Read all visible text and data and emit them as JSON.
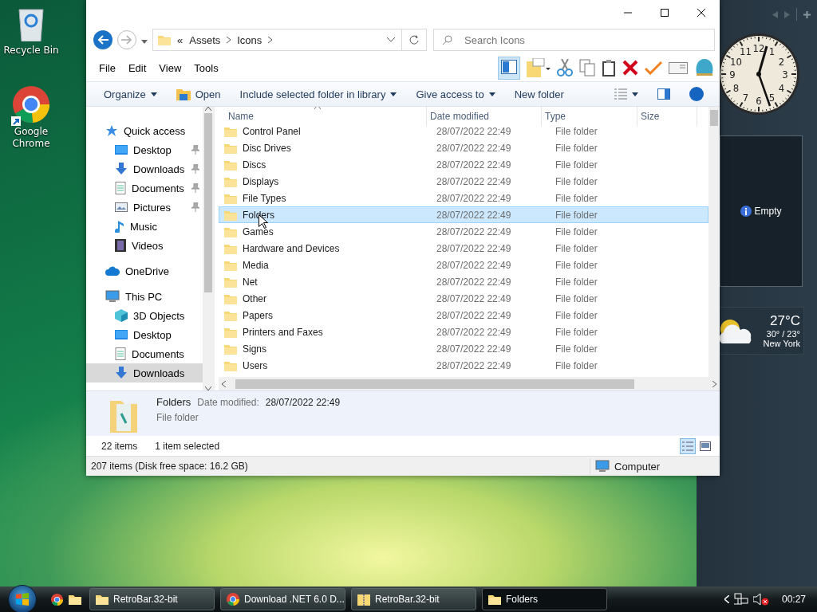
{
  "desktop_icons": [
    {
      "label": "Recycle Bin",
      "kind": "recycle"
    },
    {
      "label": "Google Chrome",
      "kind": "chrome",
      "shortcut": true
    }
  ],
  "window": {
    "address": {
      "overflow": "«",
      "crumbs": [
        "Assets",
        "Icons"
      ]
    },
    "search": {
      "placeholder": "Search Icons"
    },
    "menu": [
      "File",
      "Edit",
      "View",
      "Tools"
    ],
    "preview_pane_on": true,
    "commands": [
      {
        "label": "Organize",
        "kind": "plain",
        "dropdown": true
      },
      {
        "label": "Open",
        "kind": "open",
        "dropdown": false
      },
      {
        "label": "Include selected folder in library",
        "kind": "plain",
        "dropdown": true
      },
      {
        "label": "Give access to",
        "kind": "plain",
        "dropdown": true
      },
      {
        "label": "New folder",
        "kind": "plain",
        "dropdown": false
      }
    ],
    "nav": [
      {
        "label": "Quick access",
        "kind": "star",
        "selected": false,
        "children": [
          {
            "label": "Desktop",
            "kind": "desktop",
            "pinned": true,
            "selected": false
          },
          {
            "label": "Downloads",
            "kind": "download",
            "pinned": true,
            "selected": false
          },
          {
            "label": "Documents",
            "kind": "document",
            "pinned": true,
            "selected": false
          },
          {
            "label": "Pictures",
            "kind": "picture",
            "pinned": true,
            "selected": false
          },
          {
            "label": "Music",
            "kind": "music",
            "pinned": false,
            "selected": false
          },
          {
            "label": "Videos",
            "kind": "video",
            "pinned": false,
            "selected": false
          }
        ]
      },
      {
        "label": "OneDrive",
        "kind": "cloud",
        "selected": false
      },
      {
        "label": "This PC",
        "kind": "pc",
        "selected": false,
        "children": [
          {
            "label": "3D Objects",
            "kind": "cube",
            "pinned": false,
            "selected": false
          },
          {
            "label": "Desktop",
            "kind": "desktop",
            "pinned": false,
            "selected": false
          },
          {
            "label": "Documents",
            "kind": "document",
            "pinned": false,
            "selected": false
          },
          {
            "label": "Downloads",
            "kind": "download",
            "pinned": false,
            "selected": true
          }
        ]
      }
    ],
    "columns": [
      {
        "label": "Name",
        "sorted": true
      },
      {
        "label": "Date modified",
        "sorted": false
      },
      {
        "label": "Type",
        "sorted": false
      },
      {
        "label": "Size",
        "sorted": false
      }
    ],
    "rows": [
      {
        "name": "Control Panel",
        "date": "28/07/2022 22:49",
        "type": "File folder",
        "selected": false
      },
      {
        "name": "Disc Drives",
        "date": "28/07/2022 22:49",
        "type": "File folder",
        "selected": false
      },
      {
        "name": "Discs",
        "date": "28/07/2022 22:49",
        "type": "File folder",
        "selected": false
      },
      {
        "name": "Displays",
        "date": "28/07/2022 22:49",
        "type": "File folder",
        "selected": false
      },
      {
        "name": "File Types",
        "date": "28/07/2022 22:49",
        "type": "File folder",
        "selected": false
      },
      {
        "name": "Folders",
        "date": "28/07/2022 22:49",
        "type": "File folder",
        "selected": true
      },
      {
        "name": "Games",
        "date": "28/07/2022 22:49",
        "type": "File folder",
        "selected": false
      },
      {
        "name": "Hardware and Devices",
        "date": "28/07/2022 22:49",
        "type": "File folder",
        "selected": false
      },
      {
        "name": "Media",
        "date": "28/07/2022 22:49",
        "type": "File folder",
        "selected": false
      },
      {
        "name": "Net",
        "date": "28/07/2022 22:49",
        "type": "File folder",
        "selected": false
      },
      {
        "name": "Other",
        "date": "28/07/2022 22:49",
        "type": "File folder",
        "selected": false
      },
      {
        "name": "Papers",
        "date": "28/07/2022 22:49",
        "type": "File folder",
        "selected": false
      },
      {
        "name": "Printers and Faxes",
        "date": "28/07/2022 22:49",
        "type": "File folder",
        "selected": false
      },
      {
        "name": "Signs",
        "date": "28/07/2022 22:49",
        "type": "File folder",
        "selected": false
      },
      {
        "name": "Users",
        "date": "28/07/2022 22:49",
        "type": "File folder",
        "selected": false
      }
    ],
    "details": {
      "name": "Folders",
      "date_label": "Date modified:",
      "date": "28/07/2022 22:49",
      "type": "File folder"
    },
    "status": {
      "count": "22 items",
      "selection": "1 item selected",
      "views": [
        {
          "kind": "details",
          "selected": true
        },
        {
          "kind": "tiles",
          "selected": false
        }
      ]
    },
    "status_bar": {
      "summary": "207 items (Disk free space: 16.2 GB)",
      "location": "Computer"
    }
  },
  "sidebar": {
    "clock": {
      "numerals": [
        "12",
        "11",
        "1",
        "10",
        "2",
        "9",
        "3",
        "8",
        "4",
        "7",
        "5",
        "6"
      ]
    },
    "slideshow": {
      "message": "Empty"
    },
    "weather": {
      "temperature": "27°C",
      "range": "30° / 23°",
      "city": "New York"
    }
  },
  "taskbar": {
    "quick_launch": [
      {
        "kind": "chrome"
      },
      {
        "kind": "folder"
      }
    ],
    "tasks": [
      {
        "label": "RetroBar.32-bit",
        "kind": "folder",
        "active": false
      },
      {
        "label": "Download .NET 6.0 D...",
        "kind": "chrome",
        "active": false
      },
      {
        "label": "RetroBar.32-bit",
        "kind": "zip",
        "active": false
      },
      {
        "label": "Folders",
        "kind": "folder",
        "active": true
      }
    ],
    "clock": "00:27"
  }
}
